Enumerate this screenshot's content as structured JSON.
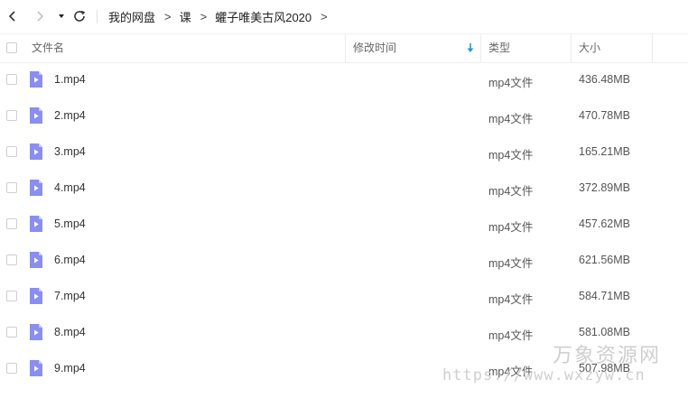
{
  "breadcrumb": {
    "items": [
      "我的网盘",
      "课",
      "蠷子唯美古风2020"
    ],
    "separator": ">"
  },
  "columns": {
    "name": "文件名",
    "modified": "修改时间",
    "type": "类型",
    "size": "大小"
  },
  "sort": {
    "column": "modified",
    "direction": "desc",
    "color": "#1e9bdb"
  },
  "icon_color": "#8a8ef0",
  "files": [
    {
      "name": "1.mp4",
      "type": "mp4文件",
      "size": "436.48MB"
    },
    {
      "name": "2.mp4",
      "type": "mp4文件",
      "size": "470.78MB"
    },
    {
      "name": "3.mp4",
      "type": "mp4文件",
      "size": "165.21MB"
    },
    {
      "name": "4.mp4",
      "type": "mp4文件",
      "size": "372.89MB"
    },
    {
      "name": "5.mp4",
      "type": "mp4文件",
      "size": "457.62MB"
    },
    {
      "name": "6.mp4",
      "type": "mp4文件",
      "size": "621.56MB"
    },
    {
      "name": "7.mp4",
      "type": "mp4文件",
      "size": "584.71MB"
    },
    {
      "name": "8.mp4",
      "type": "mp4文件",
      "size": "581.08MB"
    },
    {
      "name": "9.mp4",
      "type": "mp4文件",
      "size": "507.98MB"
    }
  ],
  "watermark": {
    "title": "万象资源网",
    "url": "https://www.wxzyw.cn"
  }
}
